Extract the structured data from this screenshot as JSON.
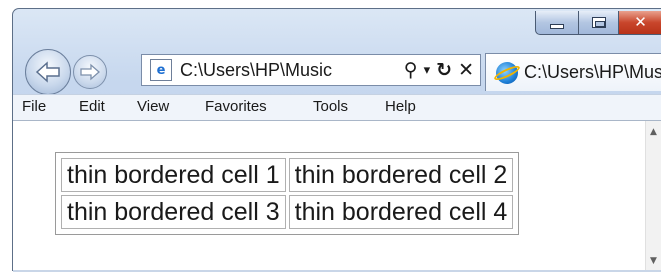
{
  "window": {
    "caption_buttons": [
      {
        "name": "minimize",
        "icon": "minimize-icon"
      },
      {
        "name": "maximize",
        "icon": "maximize-icon"
      },
      {
        "name": "close",
        "icon": "close-icon",
        "color": "#c9462c"
      }
    ]
  },
  "nav": {
    "back_icon": "back-arrow-icon",
    "forward_icon": "forward-arrow-icon"
  },
  "address": {
    "value": "C:\\Users\\HP\\Music",
    "page_icon": "ie-page-icon",
    "tools": {
      "search": "⚲",
      "dropdown": "▾",
      "refresh": "↻",
      "stop": "✕"
    }
  },
  "tab": {
    "title": "C:\\Users\\HP\\Music",
    "icon": "ie-logo-icon"
  },
  "menu": {
    "items": [
      "File",
      "Edit",
      "View",
      "Favorites",
      "Tools",
      "Help"
    ]
  },
  "table": {
    "rows": [
      [
        "thin bordered cell 1",
        "thin bordered cell 2"
      ],
      [
        "thin bordered cell 3",
        "thin bordered cell 4"
      ]
    ]
  },
  "colors": {
    "frame": "#c6d7ee",
    "close_button": "#c9462c",
    "accent": "#1d7fd6"
  }
}
